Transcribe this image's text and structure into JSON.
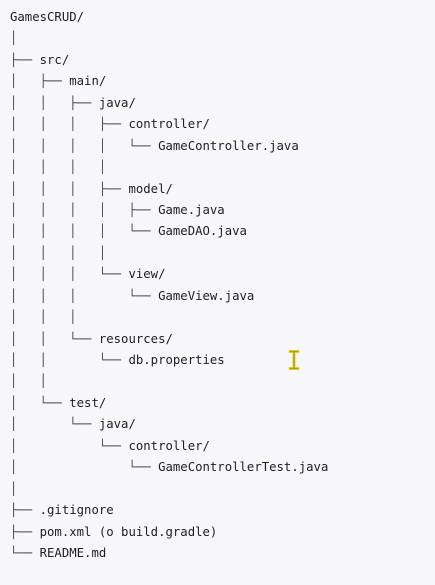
{
  "tree": [
    {
      "prefix": "",
      "name": "GamesCRUD/"
    },
    {
      "prefix": "│",
      "name": ""
    },
    {
      "prefix": "├── ",
      "name": "src/"
    },
    {
      "prefix": "│   ├── ",
      "name": "main/"
    },
    {
      "prefix": "│   │   ├── ",
      "name": "java/"
    },
    {
      "prefix": "│   │   │   ├── ",
      "name": "controller/"
    },
    {
      "prefix": "│   │   │   │   └── ",
      "name": "GameController.java"
    },
    {
      "prefix": "│   │   │   │",
      "name": ""
    },
    {
      "prefix": "│   │   │   ├── ",
      "name": "model/"
    },
    {
      "prefix": "│   │   │   │   ├── ",
      "name": "Game.java"
    },
    {
      "prefix": "│   │   │   │   └── ",
      "name": "GameDAO.java"
    },
    {
      "prefix": "│   │   │   │",
      "name": ""
    },
    {
      "prefix": "│   │   │   └── ",
      "name": "view/"
    },
    {
      "prefix": "│   │   │       └── ",
      "name": "GameView.java"
    },
    {
      "prefix": "│   │   │",
      "name": ""
    },
    {
      "prefix": "│   │   └── ",
      "name": "resources/"
    },
    {
      "prefix": "│   │       └── ",
      "name": "db.properties"
    },
    {
      "prefix": "│   │",
      "name": ""
    },
    {
      "prefix": "│   └── ",
      "name": "test/"
    },
    {
      "prefix": "│       └── ",
      "name": "java/"
    },
    {
      "prefix": "│           └── ",
      "name": "controller/"
    },
    {
      "prefix": "│               └── ",
      "name": "GameControllerTest.java"
    },
    {
      "prefix": "│",
      "name": ""
    },
    {
      "prefix": "├── ",
      "name": ".gitignore"
    },
    {
      "prefix": "├── ",
      "name": "pom.xml (o build.gradle)"
    },
    {
      "prefix": "└── ",
      "name": "README.md"
    }
  ],
  "cursor": {
    "icon": "text-cursor-icon",
    "color": "#d4c400"
  }
}
